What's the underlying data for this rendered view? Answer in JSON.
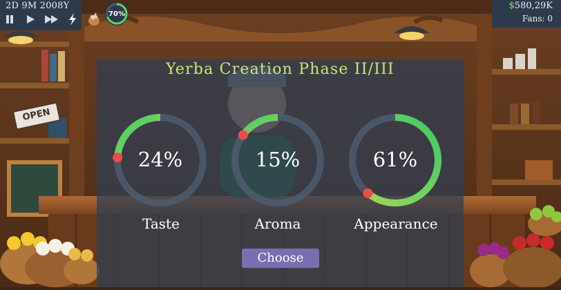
{
  "hud": {
    "date": "2D 9M 2008Y",
    "meter_label": "70%",
    "meter_value": 0.7,
    "money_currency": "$",
    "money_amount": "580,29K",
    "fans": "Fans: 0"
  },
  "scene": {
    "sign_text": "OPEN"
  },
  "dialog": {
    "title": "Yerba Creation Phase II/III",
    "gauges": [
      {
        "name": "Taste",
        "percent_label": "24%",
        "value": 0.24
      },
      {
        "name": "Aroma",
        "percent_label": "15%",
        "value": 0.15
      },
      {
        "name": "Appearance",
        "percent_label": "61%",
        "value": 0.61
      }
    ],
    "choose_label": "Choose"
  },
  "colors": {
    "hud_bg": "#2c3a4c",
    "title": "#c8ea6e",
    "gauge_track": "#4e5c6e",
    "gauge_fill_start": "#9ed65a",
    "gauge_fill_end": "#3fca66",
    "gauge_knob": "#ef4b4b",
    "button": "#7a6eb0",
    "money_currency": "#7fe36a"
  }
}
